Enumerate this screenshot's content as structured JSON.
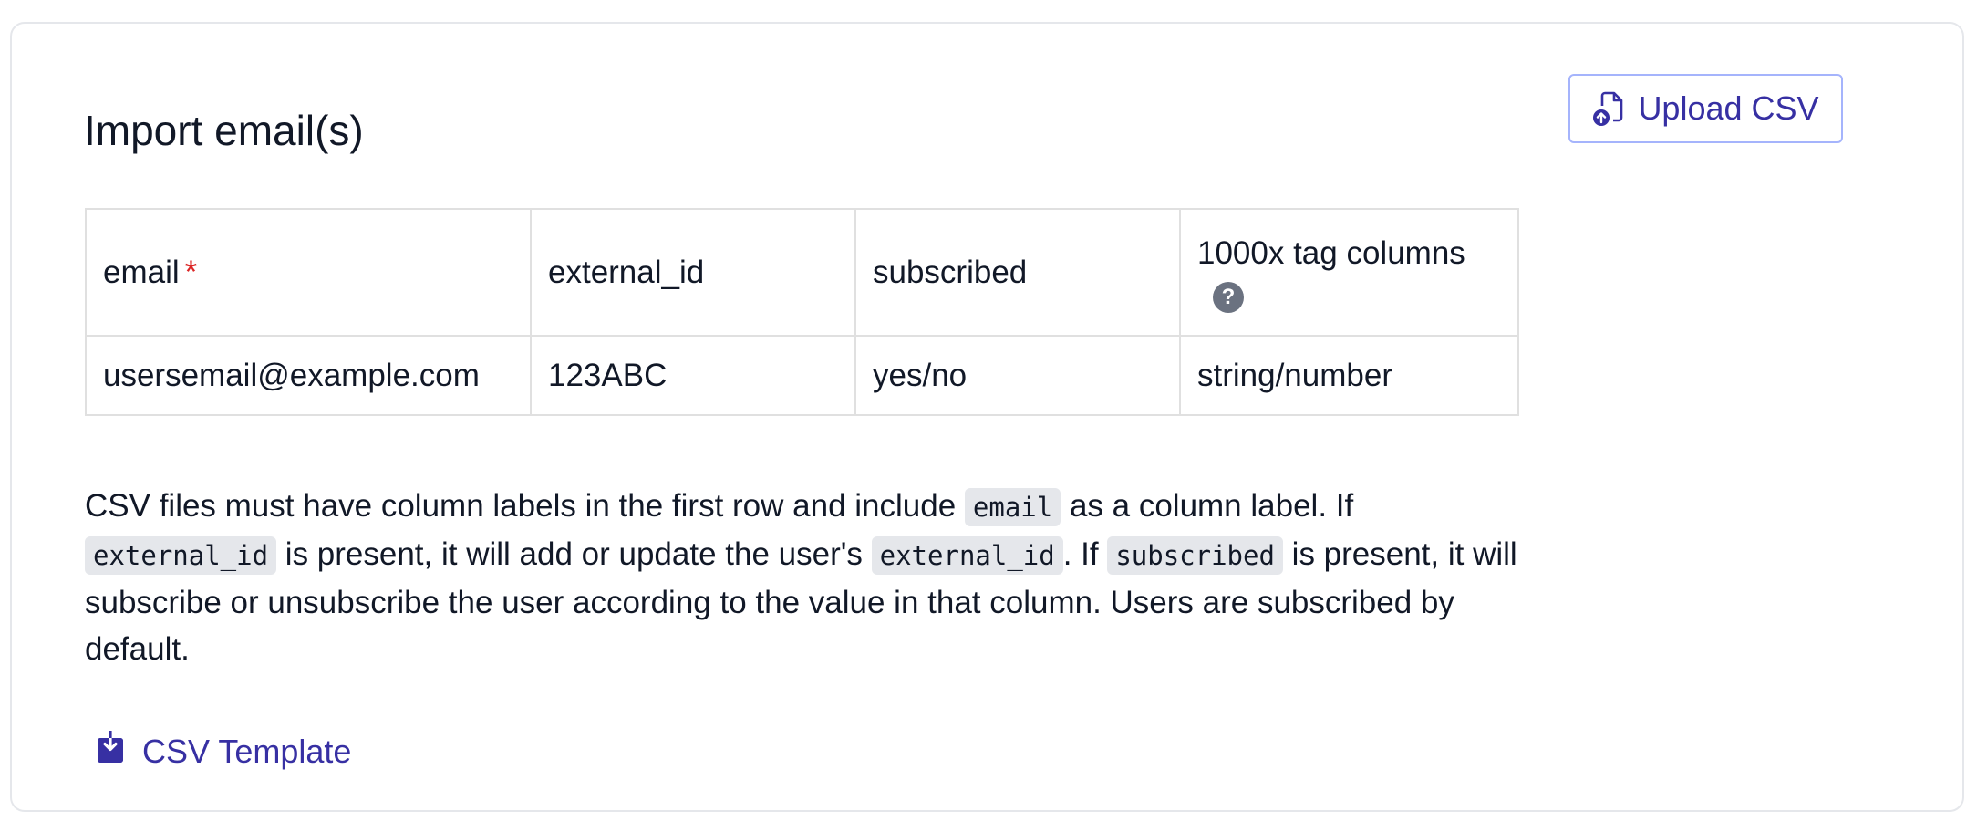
{
  "panel": {
    "title": "Import email(s)",
    "upload_button": {
      "label": "Upload CSV",
      "icon": "file-upload-icon"
    },
    "columns_table": {
      "headers": [
        "email",
        "external_id",
        "subscribed",
        "1000x tag columns"
      ],
      "required_marker": "*",
      "help_icon_glyph": "?",
      "example_row": [
        "usersemail@example.com",
        "123ABC",
        "yes/no",
        "string/number"
      ]
    },
    "description": {
      "part1": "CSV files must have column labels in the first row and include ",
      "code1": "email",
      "part2": " as a column label. If ",
      "code2": "external_id",
      "part3": " is present, it will add or update the user's ",
      "code3": "external_id",
      "part4": ". If ",
      "code4": "subscribed",
      "part5": " is present, it will subscribe or unsubscribe the user according to the value in that column. Users are subscribed by default."
    },
    "template_link": {
      "label": "CSV Template",
      "icon": "download-icon"
    }
  },
  "colors": {
    "accent": "#3730a3",
    "accent_border": "#a5b4fc",
    "required": "#dc2626",
    "help_icon_bg": "#6b7280",
    "code_bg": "#e5e7eb"
  }
}
